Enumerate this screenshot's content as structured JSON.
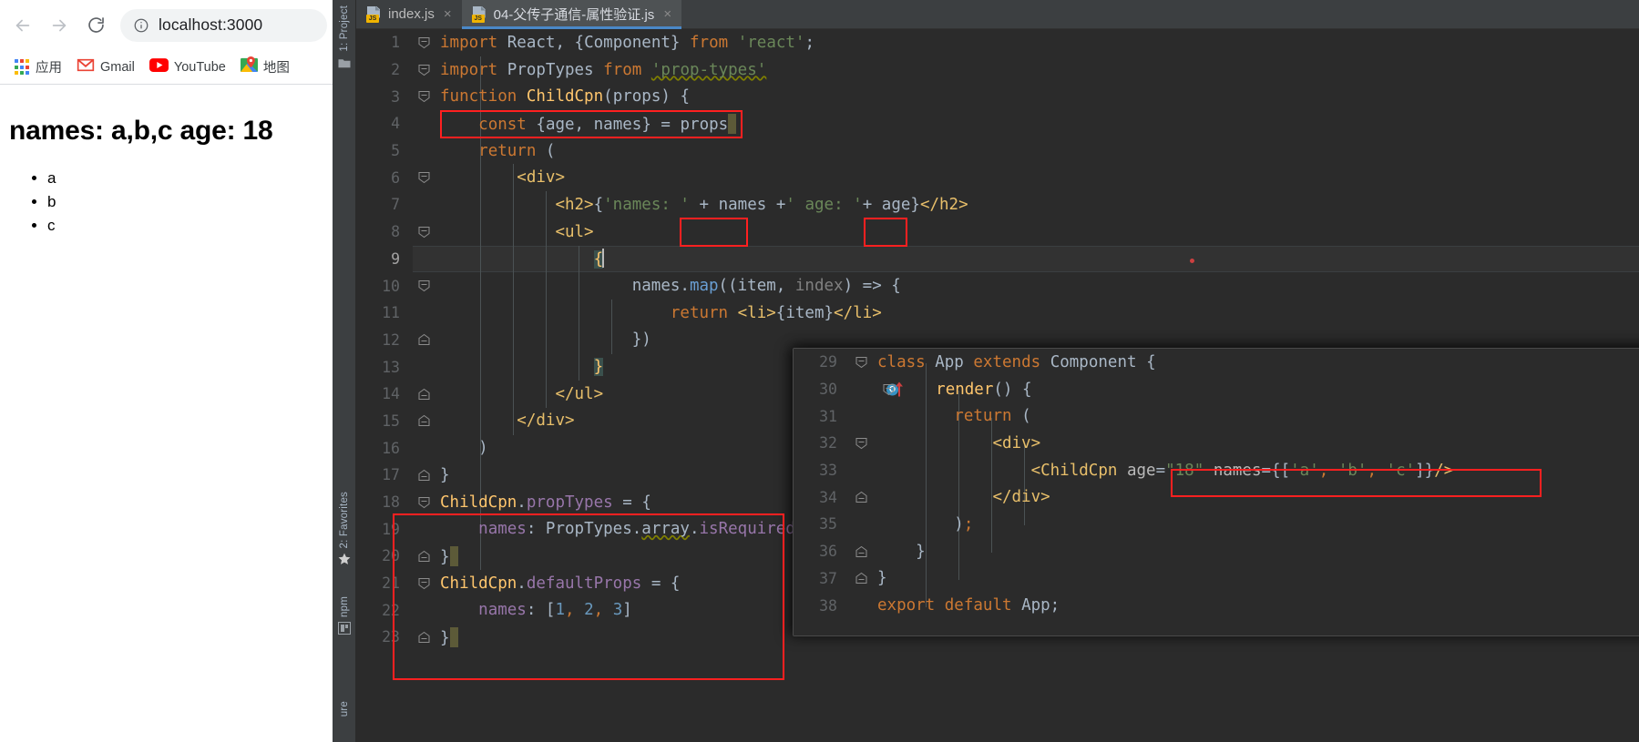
{
  "browser": {
    "nav": {
      "back": "back-arrow",
      "forward": "forward-arrow",
      "reload": "reload-arrow"
    },
    "omnibox": {
      "info_icon": "info-circle-icon",
      "host": "localhost",
      "port": ":3000",
      "url": "localhost:3000"
    },
    "bookmarks": [
      {
        "label": "应用",
        "icon": "apps-grid-icon"
      },
      {
        "label": "Gmail",
        "icon": "gmail-icon"
      },
      {
        "label": "YouTube",
        "icon": "youtube-icon"
      },
      {
        "label": "地图",
        "icon": "maps-pin-icon"
      }
    ],
    "page": {
      "heading": "names: a,b,c age: 18",
      "list": [
        "a",
        "b",
        "c"
      ]
    }
  },
  "ide": {
    "sidebar": [
      {
        "label": "1: Project",
        "icon": "folder-icon"
      },
      {
        "label": "2: Favorites",
        "icon": "star-icon"
      },
      {
        "label": "npm",
        "icon": "npm-icon"
      },
      {
        "label": "ure",
        "icon": "structure-icon"
      }
    ],
    "tabs": [
      {
        "label": "index.js",
        "active": false,
        "close": "×",
        "icon": "js-file-icon",
        "badge": "JS"
      },
      {
        "label": "04-父传子通信-属性验证.js",
        "active": true,
        "close": "×",
        "icon": "js-file-icon",
        "badge": "JS"
      }
    ],
    "main_editor": {
      "lines": [
        {
          "n": "1",
          "fold": "minus"
        },
        {
          "n": "2",
          "fold": "minus"
        },
        {
          "n": "3",
          "fold": "minus"
        },
        {
          "n": "4",
          "fold": ""
        },
        {
          "n": "5",
          "fold": ""
        },
        {
          "n": "6",
          "fold": "minus"
        },
        {
          "n": "7",
          "fold": ""
        },
        {
          "n": "8",
          "fold": "minus"
        },
        {
          "n": "9",
          "fold": ""
        },
        {
          "n": "10",
          "fold": "minus"
        },
        {
          "n": "11",
          "fold": ""
        },
        {
          "n": "12",
          "fold": "end"
        },
        {
          "n": "13",
          "fold": ""
        },
        {
          "n": "14",
          "fold": "end"
        },
        {
          "n": "15",
          "fold": "end"
        },
        {
          "n": "16",
          "fold": ""
        },
        {
          "n": "17",
          "fold": "end"
        },
        {
          "n": "18",
          "fold": "minus"
        },
        {
          "n": "19",
          "fold": ""
        },
        {
          "n": "20",
          "fold": "end"
        },
        {
          "n": "21",
          "fold": "minus"
        },
        {
          "n": "22",
          "fold": ""
        },
        {
          "n": "23",
          "fold": "end"
        }
      ],
      "code": [
        "import React, {Component} from 'react';",
        "import PropTypes from 'prop-types'",
        "function ChildCpn(props) {",
        "    const {age, names} = props",
        "    return (",
        "        <div>",
        "            <h2>{'names: ' + names +' age: '+ age}</h2>",
        "            <ul>",
        "                {",
        "                    names.map((item, index) => {",
        "                        return <li>{item}</li>",
        "                    })",
        "                }",
        "            </ul>",
        "        </div>",
        "    )",
        "}",
        "ChildCpn.propTypes = {",
        "    names: PropTypes.array.isRequired",
        "}",
        "ChildCpn.defaultProps = {",
        "    names: [1, 2, 3]",
        "}"
      ]
    },
    "popup_editor": {
      "lines": [
        {
          "n": "29",
          "fold": "minus",
          "marker": ""
        },
        {
          "n": "30",
          "fold": "minus",
          "marker": "breakpoint-override"
        },
        {
          "n": "31",
          "fold": "",
          "marker": ""
        },
        {
          "n": "32",
          "fold": "minus",
          "marker": ""
        },
        {
          "n": "33",
          "fold": "",
          "marker": ""
        },
        {
          "n": "34",
          "fold": "end",
          "marker": ""
        },
        {
          "n": "35",
          "fold": "",
          "marker": ""
        },
        {
          "n": "36",
          "fold": "end",
          "marker": ""
        },
        {
          "n": "37",
          "fold": "end",
          "marker": ""
        },
        {
          "n": "38",
          "fold": "",
          "marker": ""
        }
      ],
      "code": [
        "class App extends Component {",
        "    render() {",
        "        return (",
        "            <div>",
        "                <ChildCpn age=\"18\" names={['a', 'b', 'c']}/>",
        "            </div>",
        "        );",
        "    }",
        "}",
        "export default App;"
      ],
      "gutter_marker_label": "O"
    },
    "annotations": {
      "box_const_destructure": "const {age, names} = props",
      "box_names_expr": "names",
      "box_age_expr": "age",
      "box_proptypes_block": "ChildCpn.propTypes / ChildCpn.defaultProps",
      "box_childcpn_props": "age=\"18\" names={['a', 'b', 'c']}"
    },
    "colors": {
      "editor_bg": "#2b2b2b",
      "chrome_bg": "#3c3f41",
      "active_tab": "#4e5254",
      "tab_underline": "#4a88c7",
      "annotation": "#ff2020",
      "keyword": "#cc7832",
      "string": "#6a8759",
      "function": "#ffc66d",
      "property": "#9876aa",
      "number": "#6897bb",
      "jsx_tag": "#e8bf6a",
      "plain": "#a9b7c6"
    }
  }
}
